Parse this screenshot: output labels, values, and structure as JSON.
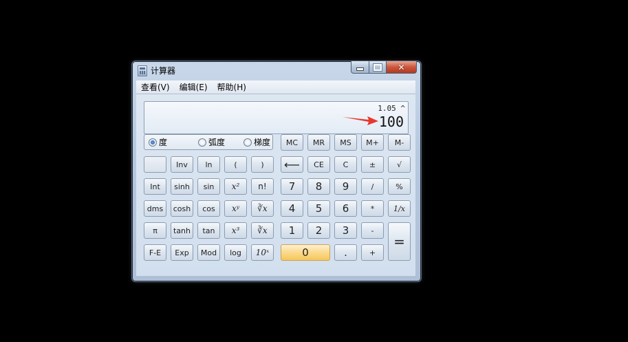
{
  "window": {
    "title": "计算器"
  },
  "menu": [
    "查看(V)",
    "编辑(E)",
    "帮助(H)"
  ],
  "display": {
    "expression": "1.05 ^",
    "result": "100"
  },
  "angle_units": {
    "options": [
      "度",
      "弧度",
      "梯度"
    ],
    "selected": "度"
  },
  "memory_buttons": [
    "MC",
    "MR",
    "MS",
    "M+",
    "M-"
  ],
  "rows": {
    "r1": [
      "",
      "Inv",
      "ln",
      "(",
      ")",
      "⟵",
      "CE",
      "C",
      "±",
      "√"
    ],
    "r2": [
      "Int",
      "sinh",
      "sin",
      "x²",
      "n!",
      "7",
      "8",
      "9",
      "/",
      "%"
    ],
    "r3": [
      "dms",
      "cosh",
      "cos",
      "xʸ",
      "∛x",
      "4",
      "5",
      "6",
      "*",
      "1/x"
    ],
    "r4": [
      "π",
      "tanh",
      "tan",
      "x³",
      "∛x",
      "1",
      "2",
      "3",
      "-",
      "="
    ],
    "r5": [
      "F-E",
      "Exp",
      "Mod",
      "log",
      "10ˣ",
      "0",
      ".",
      "+"
    ]
  },
  "annotation_arrow_color": "#e8382c"
}
